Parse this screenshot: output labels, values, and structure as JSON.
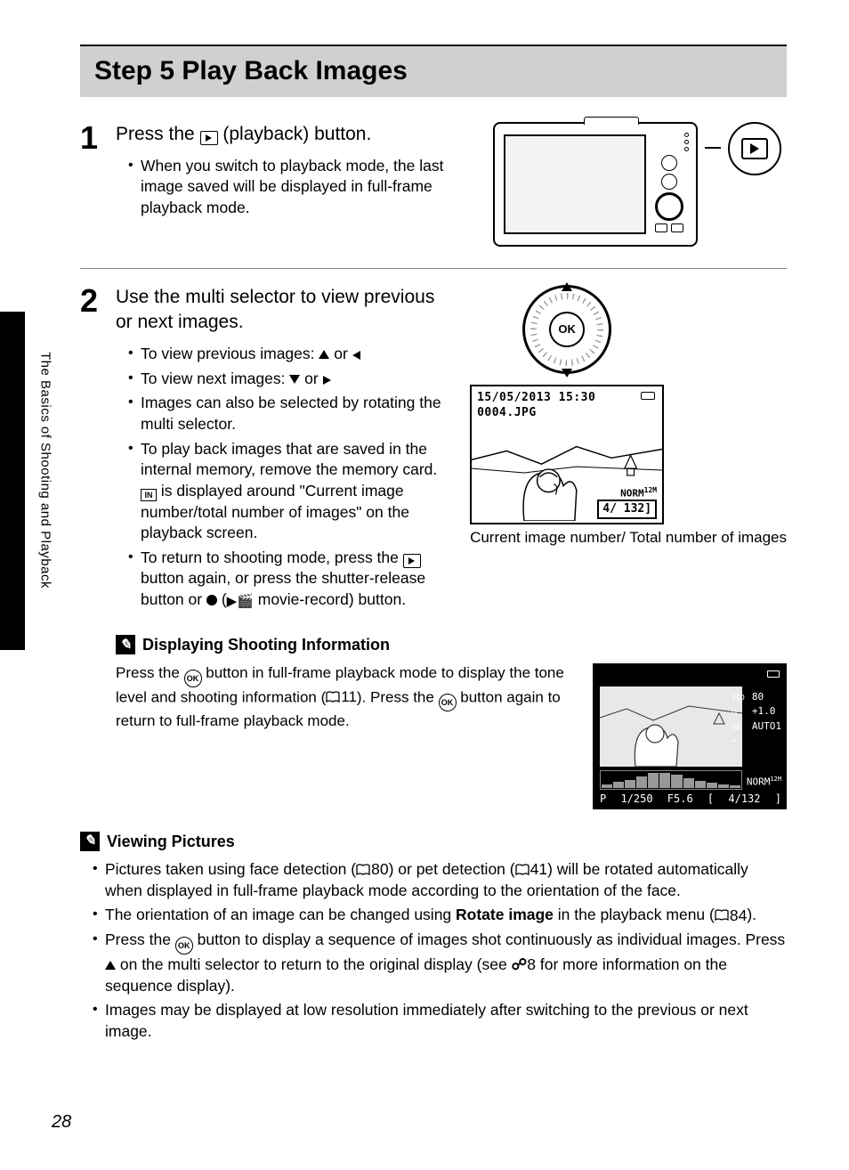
{
  "sidebar_label": "The Basics of Shooting and Playback",
  "section_title": "Step 5 Play Back Images",
  "page_number": "28",
  "step1": {
    "num": "1",
    "title_pre": "Press the ",
    "title_post": " (playback) button.",
    "bullet1": "When you switch to playback mode, the last image saved will be displayed in full-frame playback mode."
  },
  "step2": {
    "num": "2",
    "title": "Use the multi selector to view previous or next images.",
    "b1_pre": "To view previous images: ",
    "b1_mid": " or ",
    "b2_pre": "To view next images: ",
    "b2_mid": " or ",
    "b3": "Images can also be selected by rotating the multi selector.",
    "b4_pre": "To play back images that are saved in the internal memory, remove the memory card. ",
    "b4_post": " is displayed around \"Current image number/total number of images\" on the playback screen.",
    "b5_pre": "To return to shooting mode, press the ",
    "b5_mid": " button again, or press the shutter-release button or ",
    "b5_post": " movie-record) button."
  },
  "selector_ok": "OK",
  "preview": {
    "date": "15/05/2013 15:30",
    "file": "0004.JPG",
    "norm": "NORM",
    "counter": "4/ 132",
    "caption": "Current image number/ Total number of images"
  },
  "info_panel": {
    "iso": "80",
    "ev": "+1.0",
    "wb": "AUTO1",
    "norm": "NORM",
    "mode": "P",
    "shutter": "1/250",
    "aperture": "F5.6",
    "counter": "4/132"
  },
  "note1": {
    "title": "Displaying Shooting Information",
    "body_pre": "Press the ",
    "body_mid1": " button in full-frame playback mode to display the tone level and shooting information (",
    "ref1": "11",
    "body_mid2": "). Press the ",
    "body_post": " button again to return to full-frame playback mode."
  },
  "note2": {
    "title": "Viewing Pictures",
    "b1_pre": "Pictures taken using face detection (",
    "b1_ref1": "80",
    "b1_mid": ") or pet detection (",
    "b1_ref2": "41",
    "b1_post": ") will be rotated automatically when displayed in full-frame playback mode according to the orientation of the face.",
    "b2_pre": "The orientation of an image can be changed using ",
    "b2_strong": "Rotate image",
    "b2_mid": " in the playback menu (",
    "b2_ref": "84",
    "b2_post": ").",
    "b3_pre": "Press the ",
    "b3_mid1": " button to display a sequence of images shot continuously as individual images. Press ",
    "b3_mid2": " on the multi selector to return to the original display (see ",
    "b3_ref": "8",
    "b3_post": " for more information on the sequence display).",
    "b4": "Images may be displayed at low resolution immediately after switching to the previous or next image."
  }
}
